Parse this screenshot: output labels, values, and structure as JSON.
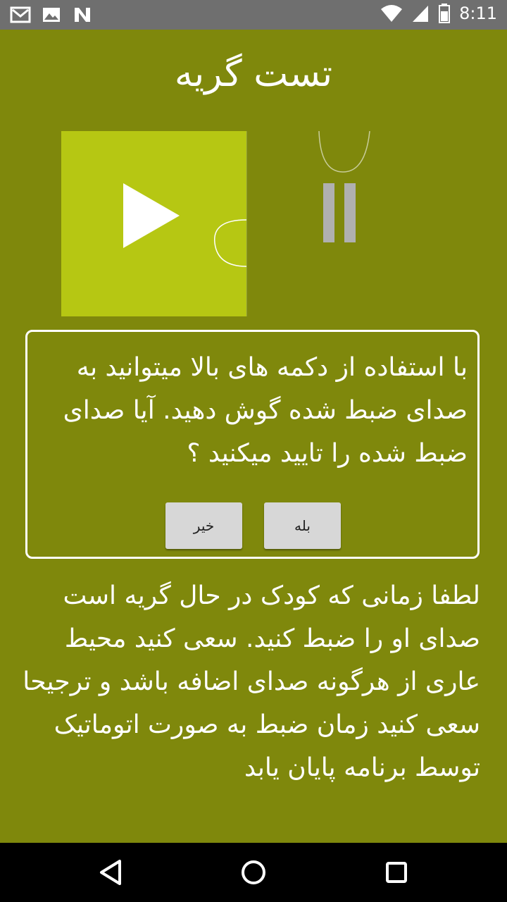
{
  "status_bar": {
    "time": "8:11",
    "icons": [
      "gmail-icon",
      "image-icon",
      "app-n-icon",
      "wifi-icon",
      "signal-icon",
      "battery-icon"
    ]
  },
  "title": "تست گریه",
  "media": {
    "play_icon": "play-icon",
    "pause_icon": "pause-icon",
    "play_color": "#b6c713",
    "pause_color": "#b0b0b0"
  },
  "dialog": {
    "message": "با استفاده از دکمه های بالا میتوانید به صدای ضبط شده گوش دهید. آیا صدای ضبط شده را تایید میکنید ؟",
    "yes_label": "بله",
    "no_label": "خیر"
  },
  "instructions": "لطفا زمانی که کودک در حال گریه است صدای او را ضبط کنید. سعی کنید محیط عاری از هرگونه صدای اضافه باشد و ترجیحا سعی کنید زمان ضبط به صورت اتوماتیک توسط برنامه پایان یابد",
  "nav": {
    "back": "back-icon",
    "home": "home-icon",
    "recent": "recent-apps-icon"
  },
  "colors": {
    "background": "#7f880c",
    "accent": "#b6c713",
    "status_bar": "#6f6f6f"
  }
}
